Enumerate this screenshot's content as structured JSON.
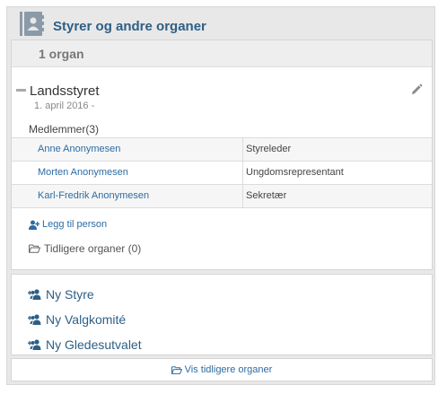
{
  "header": {
    "title": "Styrer og andre organer",
    "icon": "address-book-icon"
  },
  "organ_count": "1 organ",
  "organ": {
    "name": "Landsstyret",
    "date": "1. april 2016 -",
    "members_label": "Medlemmer(3)",
    "members": [
      {
        "name": "Anne Anonymesen",
        "role": "Styreleder"
      },
      {
        "name": "Morten Anonymesen",
        "role": "Ungdomsrepresentant"
      },
      {
        "name": "Karl-Fredrik Anonymesen",
        "role": "Sekretær"
      }
    ],
    "add_person": "Legg til person",
    "previous_organs": "Tidligere organer (0)"
  },
  "new_items": [
    {
      "label": "Ny Styre"
    },
    {
      "label": "Ny Valgkomité"
    },
    {
      "label": "Ny Gledesutvalet"
    }
  ],
  "show_previous": "Vis tidligere organer",
  "colors": {
    "accent": "#2d5f86",
    "link": "#2d6ca2",
    "frame": "#e8e8e8"
  }
}
